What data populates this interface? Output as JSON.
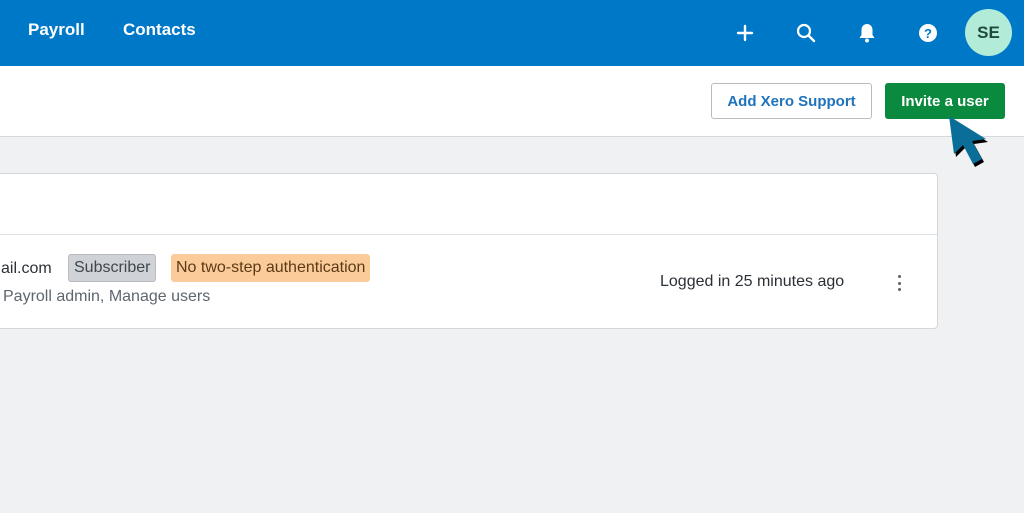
{
  "topbar": {
    "nav": [
      "Payroll",
      "Contacts"
    ],
    "icons": [
      "plus-icon",
      "search-icon",
      "bell-icon",
      "help-icon"
    ],
    "avatar_initials": "SE",
    "color": "#0078c8"
  },
  "actions": {
    "add_support": "Add Xero Support",
    "invite": "Invite a user"
  },
  "user": {
    "email_fragment": "ail.com",
    "badges": [
      "Subscriber",
      "No two-step authentication"
    ],
    "roles": "Payroll admin, Manage users",
    "last_login": "Logged in 25 minutes ago"
  }
}
